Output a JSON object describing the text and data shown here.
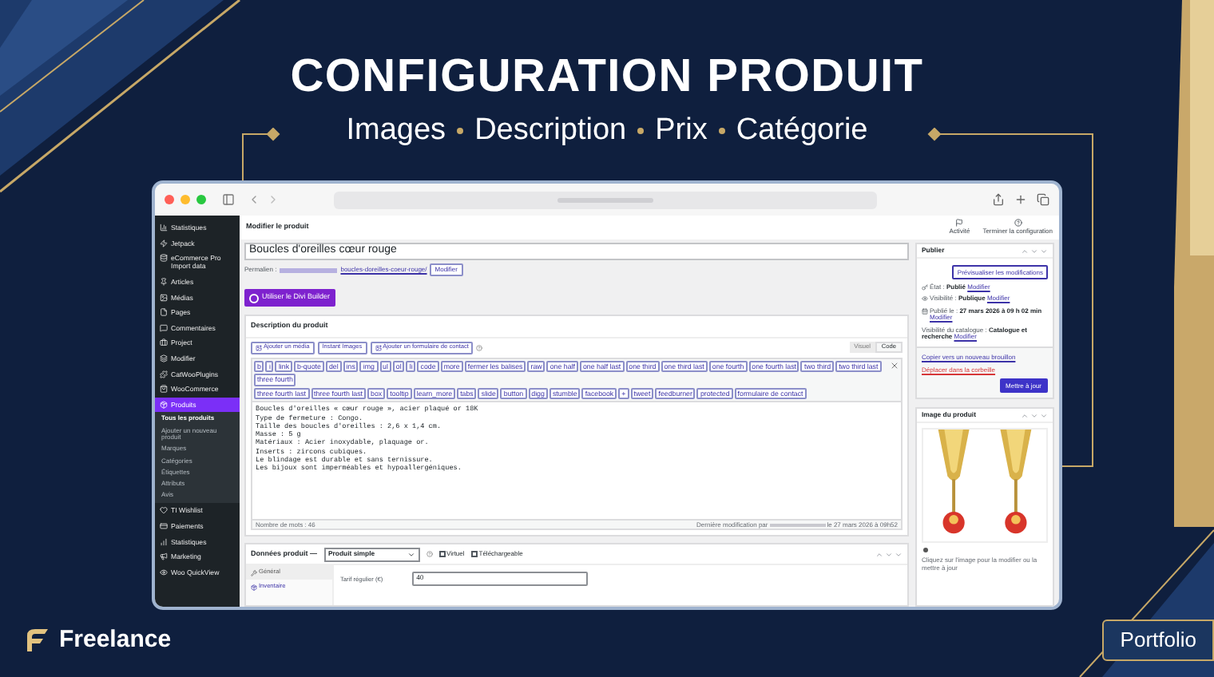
{
  "headline": {
    "title": "CONFIGURATION PRODUIT",
    "topics": [
      "Images",
      "Description",
      "Prix",
      "Catégorie"
    ]
  },
  "admin_header": {
    "page_title": "Modifier le produit",
    "actions": [
      {
        "label": "Activité"
      },
      {
        "label": "Terminer la configuration"
      }
    ]
  },
  "sidebar": {
    "items": [
      {
        "label": "Statistiques",
        "selected": false
      },
      {
        "label": "Jetpack",
        "selected": false
      },
      {
        "label": "eCommerce Pro Import data",
        "selected": false
      },
      {
        "label": "Articles",
        "selected": false
      },
      {
        "label": "Médias",
        "selected": false
      },
      {
        "label": "Pages",
        "selected": false
      },
      {
        "label": "Commentaires",
        "selected": false
      },
      {
        "label": "Project",
        "selected": false
      },
      {
        "label": "Modifier",
        "selected": false
      },
      {
        "label": "CatWooPlugins",
        "selected": false
      },
      {
        "label": "WooCommerce",
        "selected": false
      },
      {
        "label": "Produits",
        "selected": true,
        "children": [
          {
            "label": "Tous les produits",
            "selected": true
          },
          {
            "label": "Ajouter un nouveau produit",
            "selected": false
          },
          {
            "label": "Marques",
            "selected": false
          },
          {
            "label": "Catégories",
            "selected": false
          },
          {
            "label": "Étiquettes",
            "selected": false
          },
          {
            "label": "Attributs",
            "selected": false
          },
          {
            "label": "Avis",
            "selected": false
          }
        ]
      },
      {
        "label": "TI Wishlist",
        "selected": false
      },
      {
        "label": "Paiements",
        "selected": false
      },
      {
        "label": "Statistiques",
        "selected": false
      },
      {
        "label": "Marketing",
        "selected": false
      },
      {
        "label": "Woo QuickView",
        "selected": false
      }
    ]
  },
  "editor": {
    "title_value": "Boucles d'oreilles cœur rouge",
    "permalink_label": "Permalien :",
    "permalink": "boucles-doreilles-coeur-rouge/",
    "permalink_button": "Modifier",
    "builder_button": "Utiliser le Divi Builder",
    "description_title": "Description du produit",
    "media_buttons": [
      "Ajouter un média",
      "Instant Images",
      "Ajouter un formulaire de contact"
    ],
    "modes": [
      {
        "label": "Visuel",
        "selected": false
      },
      {
        "label": "Code",
        "selected": true
      }
    ],
    "quicktags": [
      [
        "b",
        "i",
        "link",
        "b-quote",
        "del",
        "ins",
        "img",
        "ul",
        "ol",
        "li",
        "code",
        "more",
        "fermer les balises",
        "raw",
        "one half",
        "one half last",
        "one third",
        "one third last",
        "one fourth",
        "one fourth last",
        "two third",
        "two third last",
        "three fourth"
      ],
      [
        "three fourth last",
        "three fourth last",
        "box",
        "tooltip",
        "learn_more",
        "tabs",
        "slide",
        "button",
        "digg",
        "stumble",
        "facebook",
        "+",
        "tweet",
        "feedburner",
        "protected",
        "formulaire de contact"
      ]
    ],
    "content_lines": [
      "Boucles d'oreilles « cœur rouge », acier plaqué or 18K",
      "Type de fermeture : Congo.",
      "Taille des boucles d'oreilles : 2,6 x 1,4 cm.",
      "Masse : 5 g",
      "Matériaux : Acier inoxydable, plaquage or.",
      "Inserts : zircons cubiques.",
      "Le blindage est durable et sans ternissure.",
      "Les bijoux sont imperméables et hypoallergéniques."
    ],
    "word_count": "Nombre de mots : 46",
    "last_modified_prefix": "Dernière modification par",
    "last_modified_suffix": "le 27 mars 2026 à 09h52"
  },
  "product_data": {
    "title": "Données produit —",
    "type": "Produit simple",
    "options": [
      {
        "label": "Virtuel",
        "checked": false
      },
      {
        "label": "Téléchargeable",
        "checked": false
      }
    ],
    "tabs": [
      {
        "label": "Général",
        "selected": true
      },
      {
        "label": "Inventaire",
        "selected": false
      }
    ],
    "price_label": "Tarif régulier (€)",
    "price_value": "40"
  },
  "publish": {
    "title": "Publier",
    "preview_button": "Prévisualiser les modifications",
    "rows": [
      {
        "label": "État :",
        "value": "Publié",
        "link": "Modifier"
      },
      {
        "label": "Visibilité :",
        "value": "Publique",
        "link": "Modifier"
      },
      {
        "label": "Publié le :",
        "value": "27 mars 2026 à 09 h 02 min",
        "link": "Modifier"
      },
      {
        "label": "Visibilité du catalogue :",
        "value": "Catalogue et recherche",
        "link": "Modifier"
      }
    ],
    "copy_link": "Copier vers un nouveau brouillon",
    "trash_link": "Déplacer dans la corbeille",
    "update_button": "Mettre à jour"
  },
  "product_image": {
    "title": "Image du produit",
    "hint": "Cliquez sur l'image pour la modifier ou la mettre à jour"
  },
  "branding": {
    "logo": "Freelance",
    "badge": "Portfolio"
  }
}
